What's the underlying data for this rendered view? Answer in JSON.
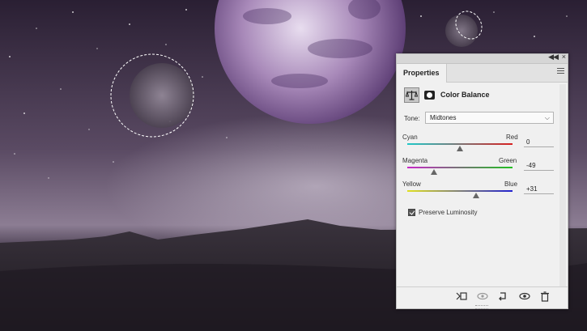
{
  "panel": {
    "tab_label": "Properties",
    "title": "Color Balance",
    "tone_label": "Tone:",
    "tone_value": "Midtones",
    "preserve_label": "Preserve Luminosity",
    "preserve_checked": true
  },
  "sliders": [
    {
      "left": "Cyan",
      "right": "Red",
      "value": "0",
      "level_fraction": 0.5,
      "colors": [
        "#1fc8c8",
        "#d82020"
      ]
    },
    {
      "left": "Magenta",
      "right": "Green",
      "value": "-49",
      "level_fraction": 0.255,
      "colors": [
        "#c828c8",
        "#20c020"
      ]
    },
    {
      "left": "Yellow",
      "right": "Blue",
      "value": "+31",
      "level_fraction": 0.655,
      "colors": [
        "#e0e020",
        "#2020d0"
      ]
    }
  ],
  "icons": [
    "collapse-icon",
    "close-icon",
    "panel-menu-icon",
    "color-balance-icon",
    "layer-mask-icon",
    "clip-to-layer-icon",
    "view-previous-state-icon",
    "reset-icon",
    "visibility-icon",
    "delete-icon"
  ]
}
